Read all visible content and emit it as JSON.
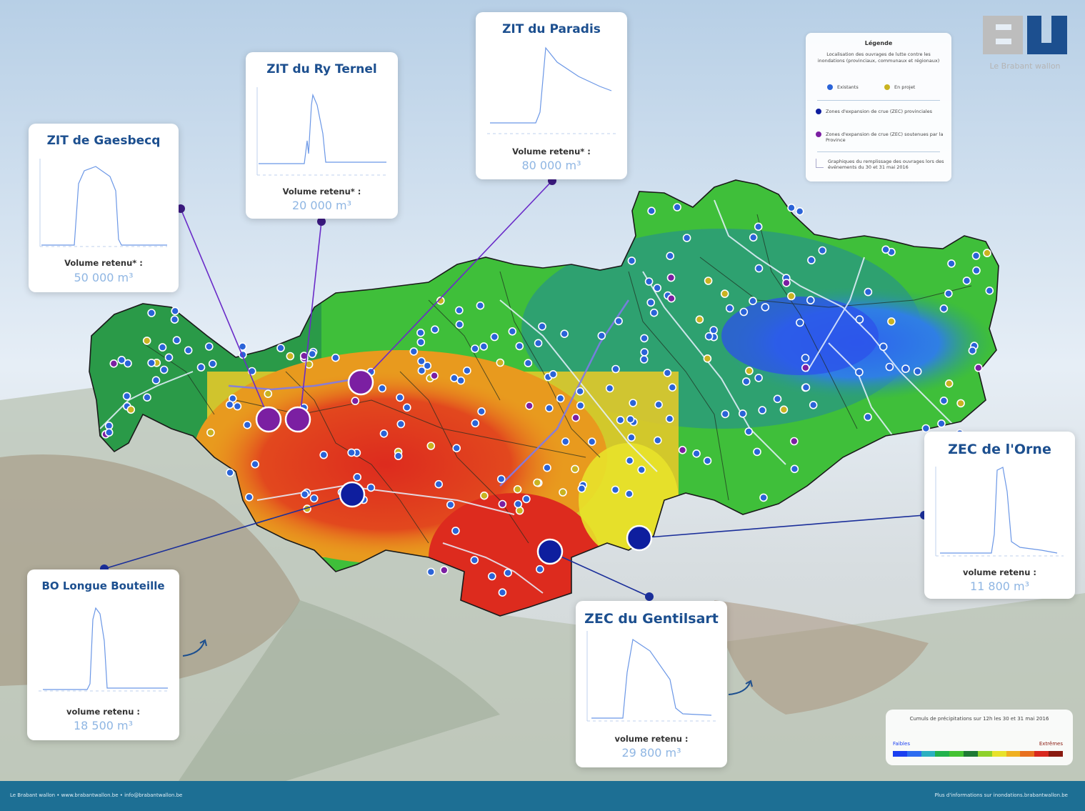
{
  "logo": {
    "text": "Le Brabant wallon"
  },
  "legend": {
    "title": "Légende",
    "subtitle": "Localisation des ouvrages de lutte contre les inondations (provinciaux, communaux et régionaux)",
    "items": [
      {
        "label": "Existants",
        "color": "#2a63d8"
      },
      {
        "label": "En projet",
        "color": "#c9b321"
      },
      {
        "label": "Zones d'expansion de crue (ZEC) provinciales",
        "color": "#0e1e9e"
      },
      {
        "label": "Zones d'expansion de crue (ZEC) soutenues par la Province",
        "color": "#7b1fa2"
      },
      {
        "label": "Graphiques du remplissage des ouvrages lors des événements du 30 et 31 mai 2016",
        "icon": "chart-line-icon"
      }
    ]
  },
  "cards": [
    {
      "id": "gaesbecq",
      "title": "ZIT de Gaesbecq",
      "vlabel": "Volume retenu* :",
      "value": "50 000 m³"
    },
    {
      "id": "ryternel",
      "title": "ZIT du Ry Ternel",
      "vlabel": "Volume retenu* :",
      "value": "20 000 m³"
    },
    {
      "id": "paradis",
      "title": "ZIT du Paradis",
      "vlabel": "Volume retenu* :",
      "value": "80 000 m³"
    },
    {
      "id": "orne",
      "title": "ZEC de l'Orne",
      "vlabel": "volume retenu :",
      "value": "11 800 m³"
    },
    {
      "id": "bouteille",
      "title": "BO Longue Bouteille",
      "vlabel": "volume retenu :",
      "value": "18 500 m³"
    },
    {
      "id": "gentilsart",
      "title": "ZEC du Gentilsart",
      "vlabel": "volume retenu :",
      "value": "29 800 m³"
    }
  ],
  "precip": {
    "title": "Cumuls de précipitations sur 12h les 30 et 31 mai 2016",
    "low": "Faibles",
    "high": "Extrêmes",
    "colors": [
      "#1a3ff0",
      "#2d6cf0",
      "#2bb0c0",
      "#22b24c",
      "#44c232",
      "#1e7a34",
      "#8fd12a",
      "#e8e22a",
      "#f0b020",
      "#e8701e",
      "#d8281e",
      "#8a1a10"
    ]
  },
  "footer": {
    "left": "Le Brabant wallon  •  www.brabantwallon.be  •  info@brabantwallon.be",
    "right": "Plus d'informations sur inondations.brabantwallon.be"
  },
  "colors": {
    "accent": "#1c4f8f",
    "footer": "#1d6f94",
    "connector": "#6a2bc8"
  }
}
